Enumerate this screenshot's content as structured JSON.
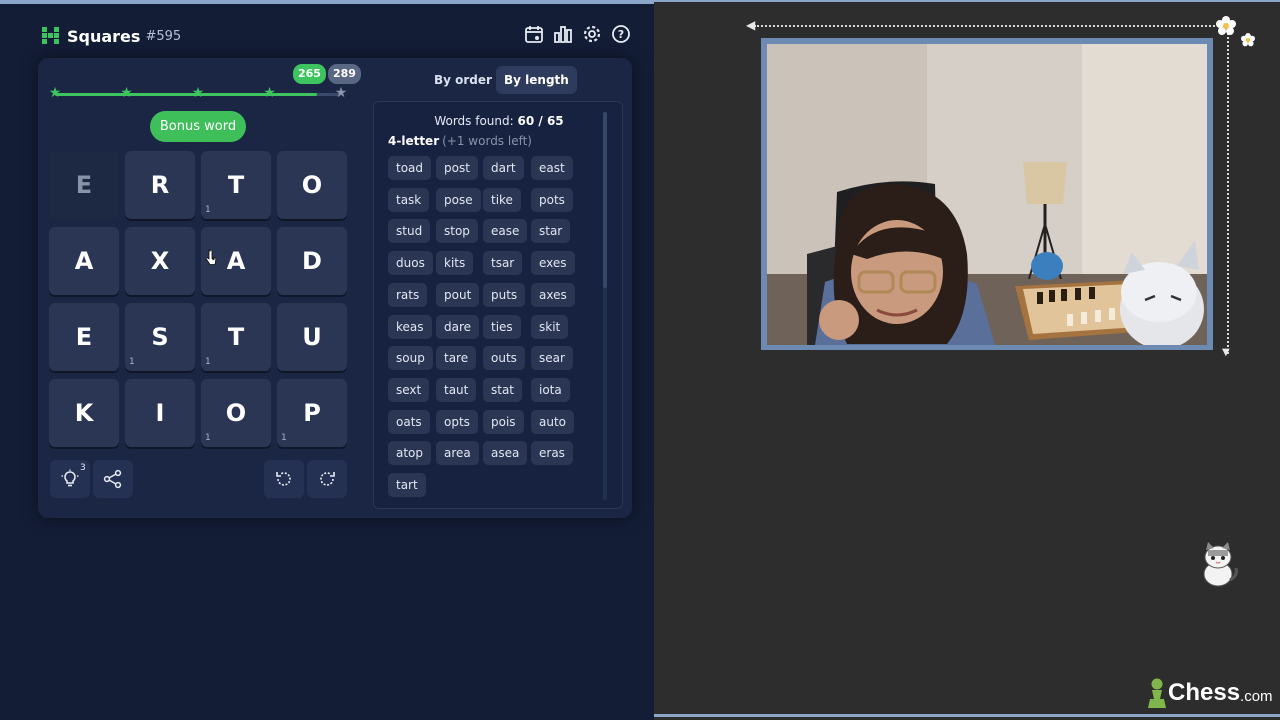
{
  "app": {
    "title": "Squares",
    "number": "#595"
  },
  "header_icons": [
    "calendar-icon",
    "stats-icon",
    "settings-icon",
    "help-icon"
  ],
  "progress": {
    "score": "265",
    "max": "289",
    "fraction": 0.917,
    "stars": 5,
    "stars_earned": 4
  },
  "bonus_label": "Bonus word",
  "tiles": [
    {
      "letter": "E",
      "count": "",
      "dim": true
    },
    {
      "letter": "R",
      "count": ""
    },
    {
      "letter": "T",
      "count": "1"
    },
    {
      "letter": "O",
      "count": ""
    },
    {
      "letter": "A",
      "count": ""
    },
    {
      "letter": "X",
      "count": ""
    },
    {
      "letter": "A",
      "count": ""
    },
    {
      "letter": "D",
      "count": ""
    },
    {
      "letter": "E",
      "count": ""
    },
    {
      "letter": "S",
      "count": "1"
    },
    {
      "letter": "T",
      "count": "1"
    },
    {
      "letter": "U",
      "count": ""
    },
    {
      "letter": "K",
      "count": ""
    },
    {
      "letter": "I",
      "count": ""
    },
    {
      "letter": "O",
      "count": "1"
    },
    {
      "letter": "P",
      "count": "1"
    }
  ],
  "hint_count": "3",
  "tabs": {
    "order": "By order",
    "length": "By length"
  },
  "words_found": {
    "label": "Words found:",
    "value": "60 / 65"
  },
  "section": {
    "heading": "4-letter",
    "remaining": "(+1 words left)"
  },
  "words": [
    "toad",
    "post",
    "dart",
    "east",
    "task",
    "pose",
    "tike",
    "pots",
    "stud",
    "stop",
    "ease",
    "star",
    "duos",
    "kits",
    "tsar",
    "exes",
    "rats",
    "pout",
    "puts",
    "axes",
    "keas",
    "dare",
    "ties",
    "skit",
    "soup",
    "tare",
    "outs",
    "sear",
    "sext",
    "taut",
    "stat",
    "iota",
    "oats",
    "opts",
    "pois",
    "auto",
    "atop",
    "area",
    "asea",
    "eras",
    "tart"
  ],
  "brand": {
    "name": "Chess",
    "suffix": ".com"
  },
  "colors": {
    "accent_green": "#3ec45f",
    "panel_bg": "#131d36",
    "tile_bg": "#2a3654"
  }
}
